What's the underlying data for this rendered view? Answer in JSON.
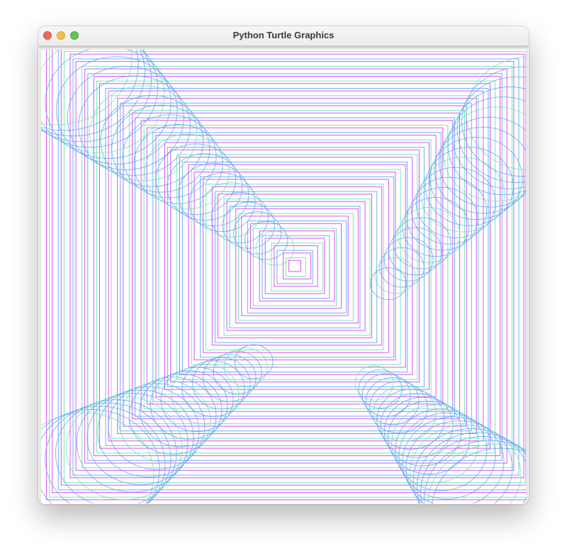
{
  "window": {
    "title": "Python Turtle Graphics"
  },
  "controls": {
    "close": "close-window",
    "minimize": "minimize-window",
    "zoom": "zoom-window"
  },
  "drawing": {
    "background": "#ffffff",
    "colors": {
      "magenta": "#d640f5",
      "mint": "#6fe0b4",
      "sky": "#5aa8f0"
    },
    "shapes": [
      "nested-squares",
      "circle-tubes"
    ]
  }
}
